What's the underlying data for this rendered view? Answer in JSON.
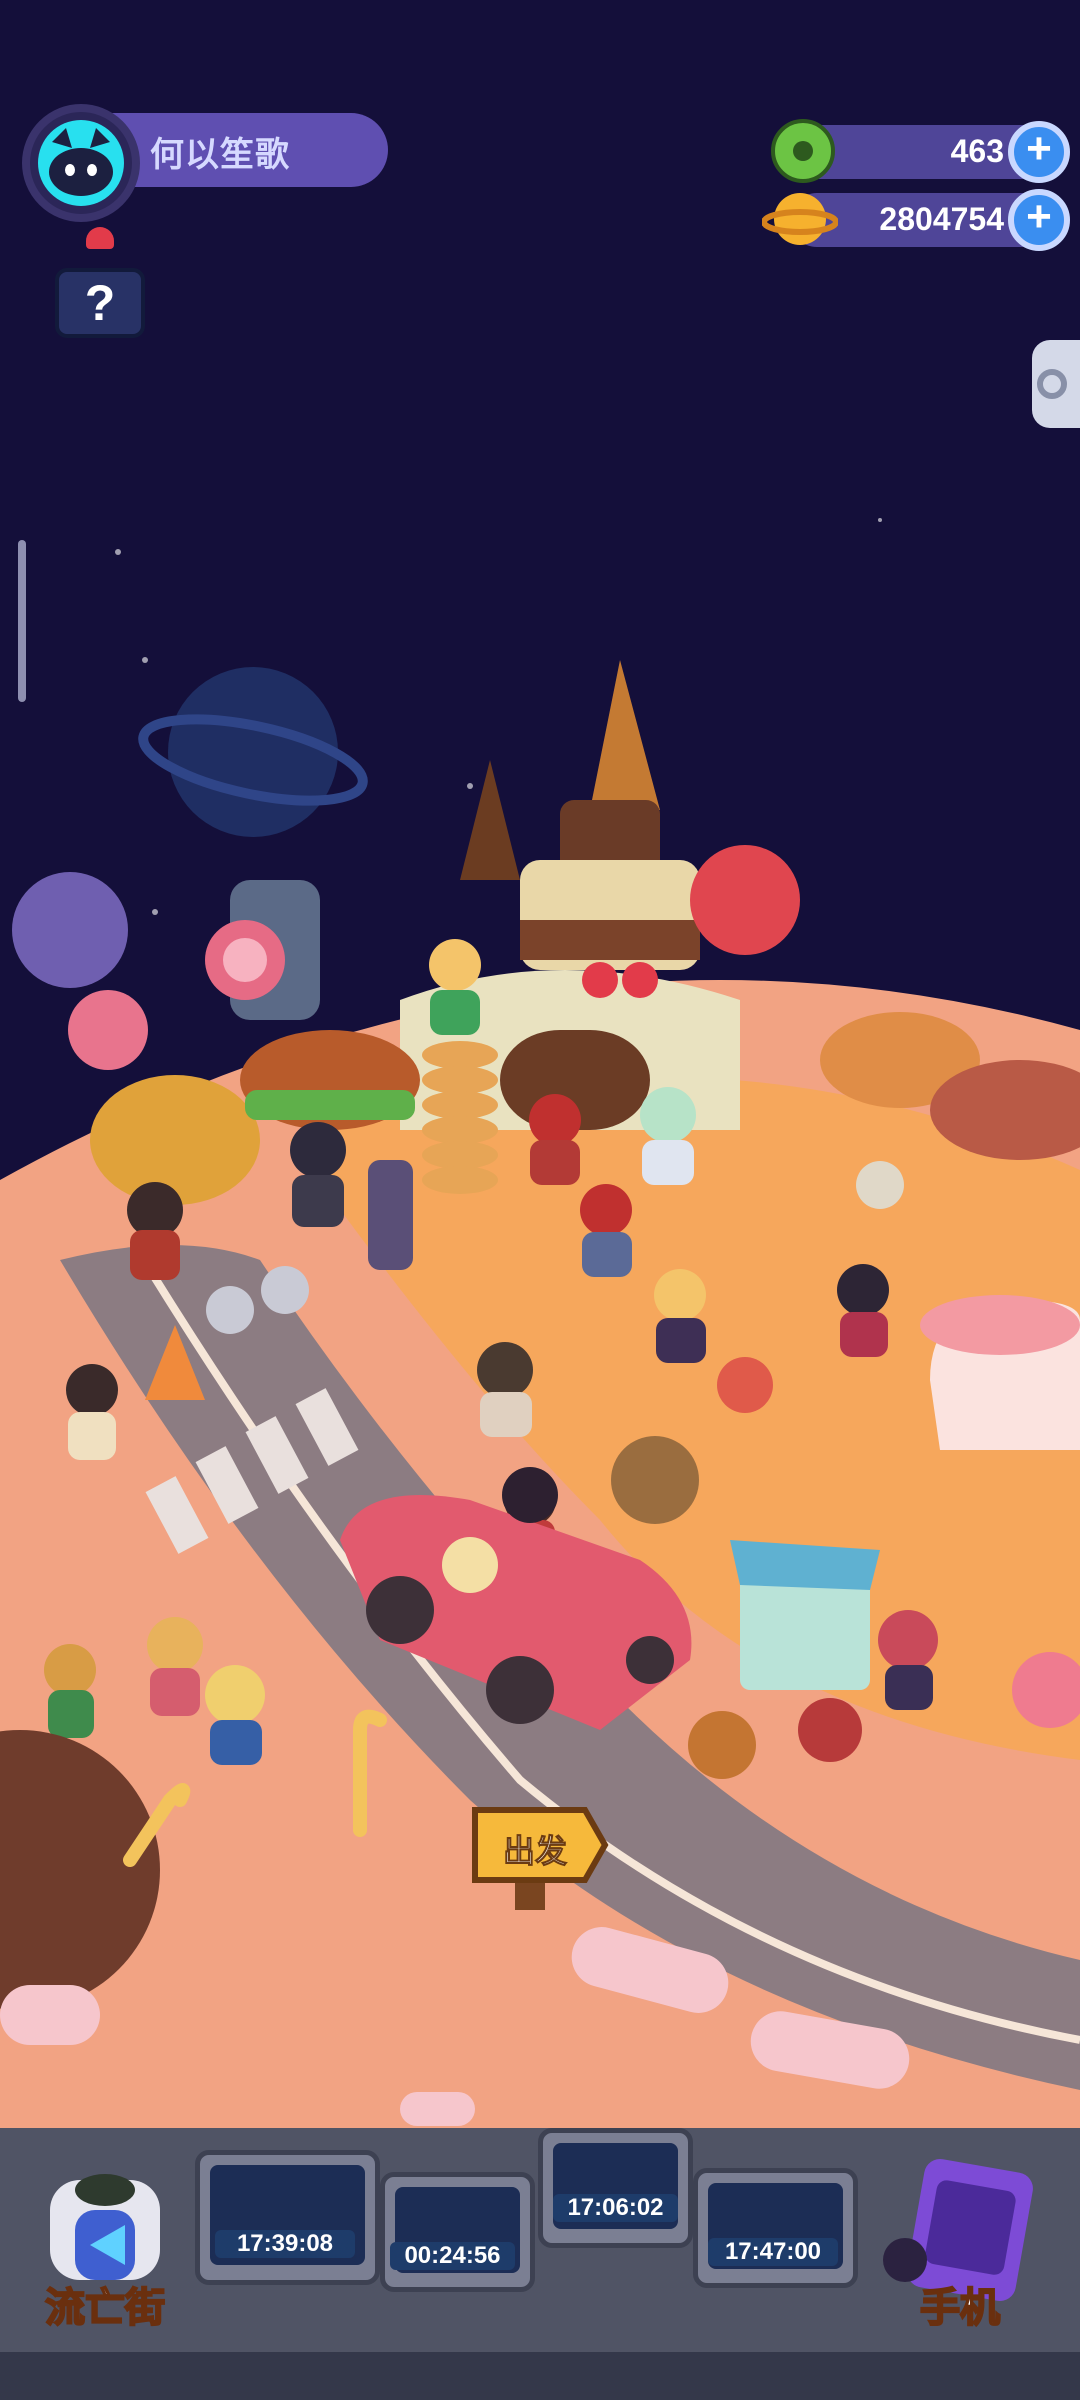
{
  "player": {
    "name": "何以笙歌"
  },
  "currency": {
    "donuts": {
      "value": "463",
      "icon": "donut-icon"
    },
    "coins": {
      "value": "2804754",
      "icon": "planet-coin-icon"
    }
  },
  "scene": {
    "signpost_label": "出发"
  },
  "dock": {
    "timers": [
      {
        "time": "17:39:08"
      },
      {
        "time": "00:24:56"
      },
      {
        "time": "17:06:02"
      },
      {
        "time": "17:47:00"
      }
    ],
    "left_button": "流亡街",
    "right_button": "手机"
  },
  "colors": {
    "space": "#140f3a",
    "ground": "#f5a982",
    "plaza": "#f7a65a",
    "road": "#8a7a80",
    "accent": "#5f4fb1"
  }
}
